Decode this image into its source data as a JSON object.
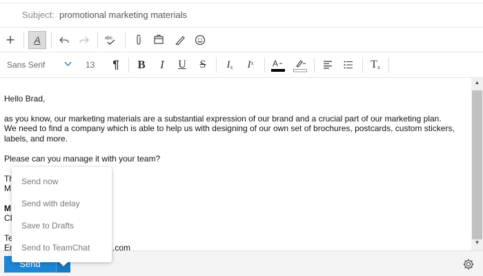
{
  "subject": {
    "label": "Subject:",
    "value": "promotional marketing materials"
  },
  "toolbar": {
    "icons": [
      "plus-icon",
      "text-format-icon",
      "undo-icon",
      "redo-icon",
      "spellcheck-icon",
      "attachment-icon",
      "insert-file-icon",
      "signature-pen-icon",
      "emoji-icon"
    ]
  },
  "format": {
    "font_family": "Sans Serif",
    "font_size": "13",
    "text_color": "#000000",
    "highlight_color": "#ffffff",
    "buttons": [
      "paragraph-icon",
      "bold-icon",
      "italic-icon",
      "underline-icon",
      "strikethrough-icon",
      "subscript-icon",
      "superscript-icon",
      "text-color-icon",
      "highlight-color-icon",
      "align-left-icon",
      "bulleted-list-icon",
      "clear-formatting-icon"
    ]
  },
  "body": {
    "greeting": "Hello Brad,",
    "line1": "as you know, our marketing materials are a substantial expression of our brand and a crucial part of our marketing plan.",
    "line2": "We need to find a company which is able to help us  with designing of our own set of brochures, postcards, custom stickers,",
    "line3": "labels, and more.",
    "line4": "Please can you manage it with your team?",
    "thanks_partial": "Th",
    "name_partial": "M",
    "bold_partial": "M",
    "title_partial": "CE",
    "tel_partial": "Te",
    "email_partial": "Em",
    "email_tail": ".com"
  },
  "send": {
    "label": "Send",
    "menu": [
      "Send now",
      "Send with delay",
      "Save to Drafts",
      "Send to TeamChat"
    ]
  },
  "colors": {
    "accent": "#1d86d5",
    "accent_dark": "#1a78c1"
  }
}
